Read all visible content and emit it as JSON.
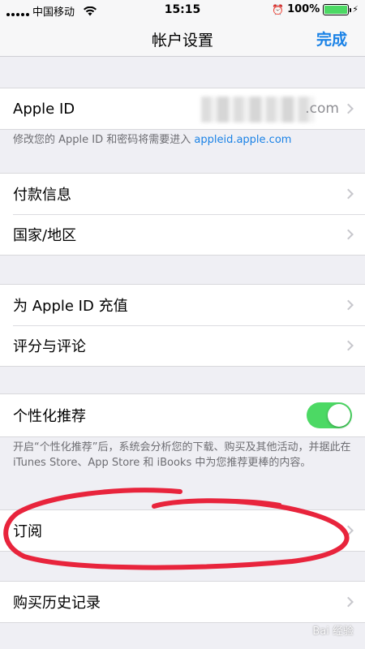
{
  "status_bar": {
    "carrier": "中国移动",
    "time": "15:15",
    "battery_percent": "100%",
    "battery_level": 1.0
  },
  "nav": {
    "title": "帐户设置",
    "done_label": "完成"
  },
  "apple_id_section": {
    "label": "Apple ID",
    "value_suffix": ".com",
    "footer_prefix": "修改您的 Apple ID 和密码将需要进入 ",
    "footer_link": "appleid.apple.com"
  },
  "payment_section": {
    "items": [
      {
        "label": "付款信息"
      },
      {
        "label": "国家/地区"
      }
    ]
  },
  "topup_section": {
    "items": [
      {
        "label": "为 Apple ID 充值"
      },
      {
        "label": "评分与评论"
      }
    ]
  },
  "personalization": {
    "label": "个性化推荐",
    "enabled": true,
    "toggle_color": "#4cd964",
    "footer": "开启“个性化推荐”后，系统会分析您的下载、购买及其他活动，并据此在 iTunes Store、App Store 和 iBooks 中为您推荐更棒的内容。"
  },
  "subscriptions": {
    "label": "订阅"
  },
  "history": {
    "label": "购买历史记录"
  },
  "annotation": {
    "color": "#e8243c"
  },
  "watermark": {
    "text": "Bai 经验"
  },
  "colors": {
    "accent": "#1a82e6",
    "background": "#efeff4"
  }
}
